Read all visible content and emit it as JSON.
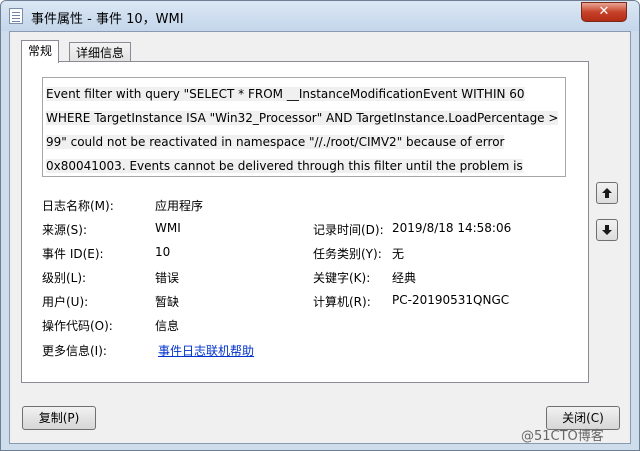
{
  "window": {
    "title": "事件属性 - 事件 10，WMI",
    "close_glyph": "✕"
  },
  "tabs": [
    {
      "label": "常规",
      "active": true
    },
    {
      "label": "详细信息",
      "active": false
    }
  ],
  "general": {
    "description": "Event filter with query \"SELECT * FROM __InstanceModificationEvent WITHIN 60 WHERE TargetInstance ISA \"Win32_Processor\" AND TargetInstance.LoadPercentage > 99\" could not be reactivated in namespace \"//./root/CIMV2\" because of error 0x80041003. Events cannot be delivered through this filter until the problem is corrected.",
    "fields": {
      "log_name": {
        "label": "日志名称(M):",
        "value": "应用程序"
      },
      "source": {
        "label": "来源(S):",
        "value": "WMI"
      },
      "event_id": {
        "label": "事件 ID(E):",
        "value": "10"
      },
      "level": {
        "label": "级别(L):",
        "value": "错误"
      },
      "user": {
        "label": "用户(U):",
        "value": "暂缺"
      },
      "opcode": {
        "label": "操作代码(O):",
        "value": "信息"
      },
      "more_info": {
        "label": "更多信息(I):",
        "value": "事件日志联机帮助"
      },
      "logged": {
        "label": "记录时间(D):",
        "value": "2019/8/18 14:58:06"
      },
      "task_category": {
        "label": "任务类别(Y):",
        "value": "无"
      },
      "keywords": {
        "label": "关键字(K):",
        "value": "经典"
      },
      "computer": {
        "label": "计算机(R):",
        "value": "PC-20190531QNGC"
      }
    }
  },
  "buttons": {
    "copy": "复制(P)",
    "close": "关闭(C)"
  },
  "icons": {
    "up": "arrow-up-icon",
    "down": "arrow-down-icon"
  },
  "watermark": "@51CTO博客"
}
